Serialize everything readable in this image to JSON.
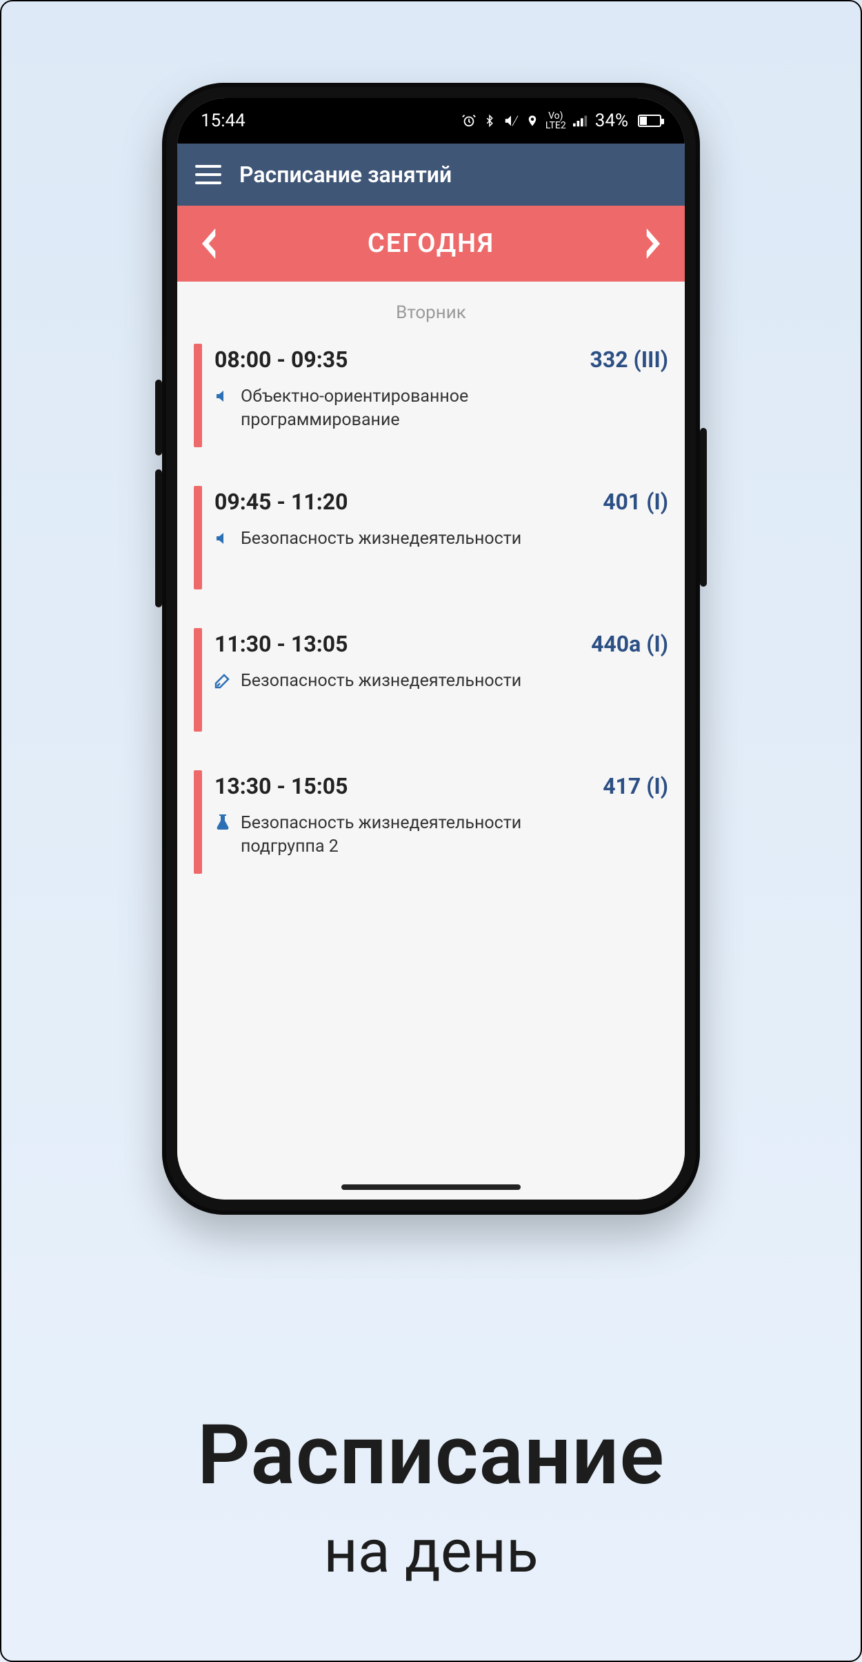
{
  "status": {
    "time": "15:44",
    "battery_pct": "34%"
  },
  "header": {
    "title": "Расписание занятий"
  },
  "datebar": {
    "label": "СЕГОДНЯ"
  },
  "day_name": "Вторник",
  "lessons": [
    {
      "time": "08:00 - 09:35",
      "room": "332 (III)",
      "type": "lecture",
      "title": "Объектно-ориентированное программирование"
    },
    {
      "time": "09:45 - 11:20",
      "room": "401 (I)",
      "type": "lecture",
      "title": "Безопасность жизнедеятельности"
    },
    {
      "time": "11:30 - 13:05",
      "room": "440а (I)",
      "type": "practice",
      "title": "Безопасность жизнедеятельности"
    },
    {
      "time": "13:30 - 15:05",
      "room": "417 (I)",
      "type": "lab",
      "title": "Безопасность жизнедеятельности подгруппа 2"
    }
  ],
  "caption": {
    "line1": "Расписание",
    "line2": "на день"
  },
  "colors": {
    "accent": "#ee6a6a",
    "header": "#3f5677",
    "room": "#2c4f84"
  }
}
